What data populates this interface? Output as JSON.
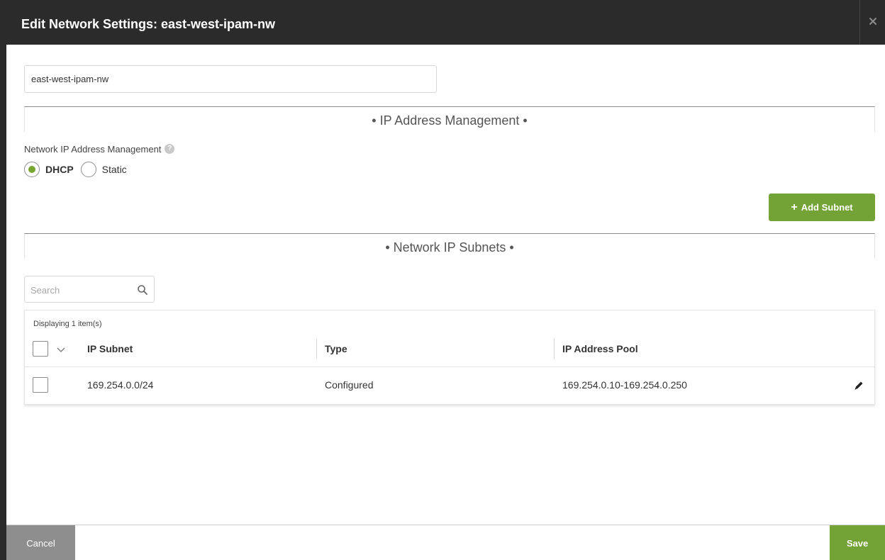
{
  "dialog": {
    "title": "Edit Network Settings: east-west-ipam-nw",
    "close_icon": "close-icon"
  },
  "network_name": {
    "value": "east-west-ipam-nw"
  },
  "ipam_section": {
    "title": "• IP Address Management •",
    "field_label": "Network IP Address Management",
    "help_icon": "help-icon",
    "options": [
      {
        "label": "DHCP",
        "checked": true
      },
      {
        "label": "Static",
        "checked": false
      }
    ],
    "accent_color": "#76a530"
  },
  "add_subnet_button": {
    "icon": "+",
    "label": "Add Subnet"
  },
  "subnets_section": {
    "title": "• Network IP Subnets •"
  },
  "search": {
    "placeholder": "Search",
    "value": ""
  },
  "table": {
    "count_text": "Displaying 1 item(s)",
    "columns": [
      "IP Subnet",
      "Type",
      "IP Address Pool"
    ],
    "rows": [
      {
        "ip_subnet": "169.254.0.0/24",
        "type": "Configured",
        "ip_address_pool": "169.254.0.10-169.254.0.250",
        "selected": false
      }
    ]
  },
  "footer": {
    "cancel_label": "Cancel",
    "save_label": "Save",
    "primary_color": "#73a236"
  }
}
